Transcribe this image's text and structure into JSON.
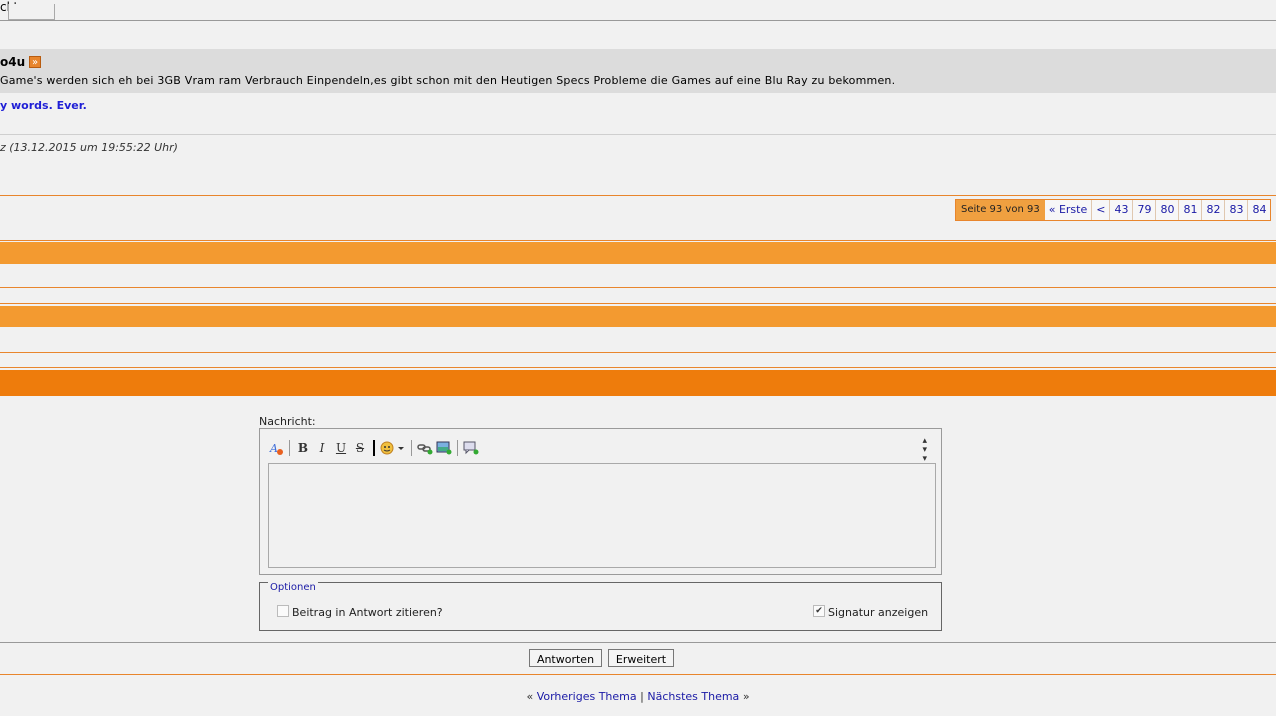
{
  "post": {
    "top_text": "ckt.",
    "author": "o4u",
    "message": "Game's werden sich eh bei 3GB Vram ram Verbrauch Einpendeln,es gibt schon mit den Heutigen Specs Probleme die Games auf eine Blu Ray zu bekommen.",
    "signature": "y words. Ever.",
    "edit_note": "z (13.12.2015 um 19:55:22 Uhr)"
  },
  "pagination": {
    "current": "Seite 93 von 93",
    "first": "« Erste",
    "prev": "<",
    "pages": [
      "43",
      "79",
      "80",
      "81",
      "82",
      "83",
      "84"
    ]
  },
  "reply": {
    "label": "Nachricht:",
    "text": "",
    "toolbar": {
      "remove_format": "remove-format-icon",
      "bold": "B",
      "italic": "I",
      "underline": "U",
      "strike": "S",
      "smilies": "smiley-icon",
      "link": "link-icon",
      "image": "image-icon",
      "quote": "quote-icon"
    },
    "options_legend": "Optionen",
    "quote_label": "Beitrag in Antwort zitieren?",
    "signature_label": "Signatur anzeigen",
    "reply_button": "Antworten",
    "advanced_button": "Erweitert"
  },
  "nav": {
    "open": "«",
    "prev_thread": "Vorheriges Thema",
    "separator": "|",
    "next_thread": "Nächstes Thema",
    "close": "»"
  },
  "colors": {
    "orange_light": "#f39a30",
    "orange_dark": "#ee7c0c",
    "link": "#1a1aa6"
  }
}
